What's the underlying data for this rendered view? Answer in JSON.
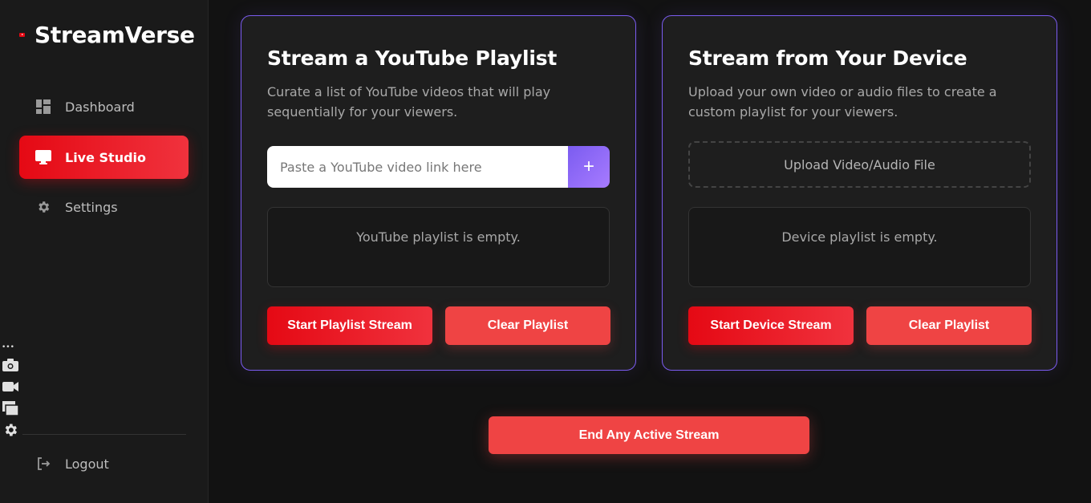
{
  "brand": {
    "name": "StreamVerse"
  },
  "nav": {
    "items": [
      {
        "label": "Dashboard",
        "icon": "dashboard-icon"
      },
      {
        "label": "Live Studio",
        "icon": "monitor-icon",
        "active": true
      },
      {
        "label": "Settings",
        "icon": "gear-icon"
      }
    ],
    "logout": {
      "label": "Logout",
      "icon": "logout-icon"
    }
  },
  "youtube_panel": {
    "title": "Stream a YouTube Playlist",
    "description": "Curate a list of YouTube videos that will play sequentially for your viewers.",
    "input_placeholder": "Paste a YouTube video link here",
    "input_value": "",
    "add_label": "+",
    "empty_text": "YouTube playlist is empty.",
    "start_label": "Start Playlist Stream",
    "clear_label": "Clear Playlist"
  },
  "device_panel": {
    "title": "Stream from Your Device",
    "description": "Upload your own video or audio files to create a custom playlist for your viewers.",
    "upload_label": "Upload Video/Audio File",
    "empty_text": "Device playlist is empty.",
    "start_label": "Start Device Stream",
    "clear_label": "Clear Playlist"
  },
  "end_stream_label": "End Any Active Stream",
  "colors": {
    "accent_red": "#e50914",
    "secondary_red": "#ef4444",
    "accent_purple": "#7b5cf0",
    "background": "#121212",
    "sidebar": "#1a1a1a"
  }
}
